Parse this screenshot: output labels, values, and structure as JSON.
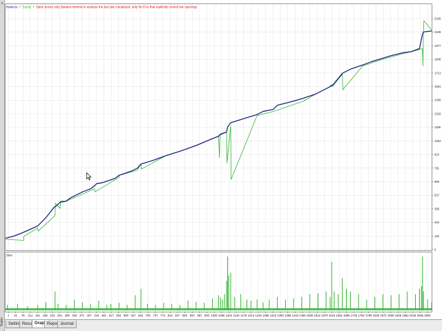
{
  "window": {
    "sidebar_label": "Tester",
    "close_glyph": "×"
  },
  "tabs": [
    {
      "label": "Settings",
      "active": false
    },
    {
      "label": "Results",
      "active": false
    },
    {
      "label": "Graph",
      "active": true
    },
    {
      "label": "Report",
      "active": false
    },
    {
      "label": "Journal",
      "active": false
    }
  ],
  "legend": {
    "balance_label": "Balance",
    "equity_label": "Equity",
    "note": "Open prices only (fastest method to analyze the bar just completed, only for EAs that explicitly control bar opening)",
    "separator": "/"
  },
  "size_panel": {
    "label": "Size"
  },
  "colors": {
    "balance": "#1a237e",
    "equity": "#2fb52f",
    "note": "#dd0000",
    "size_bars": "#2fb52f",
    "grid": "#c6c6c6"
  },
  "chart_data": {
    "type": "line",
    "y_ticks": [
      "2240",
      "2109",
      "1977",
      "1845",
      "1713",
      "1581",
      "1450",
      "1318",
      "1186",
      "1054",
      "922",
      "791",
      "659",
      "527",
      "395",
      "264",
      "132",
      "0"
    ],
    "ylim": [
      0,
      2240
    ],
    "x_ticks": [
      "1",
      "41",
      "78",
      "114",
      "151",
      "188",
      "224",
      "261",
      "298",
      "334",
      "371",
      "407",
      "444",
      "481",
      "517",
      "554",
      "590",
      "627",
      "664",
      "700",
      "737",
      "774",
      "810",
      "847",
      "883",
      "920",
      "957",
      "993",
      "1030",
      "1066",
      "1103",
      "1140",
      "1176",
      "1213",
      "1249",
      "1286",
      "1323",
      "1359",
      "1396",
      "1433",
      "1469",
      "1506",
      "1542",
      "1579",
      "1616",
      "1652",
      "1689",
      "1725",
      "1762",
      "1799",
      "1835",
      "1872",
      "1908",
      "1945",
      "1982",
      "2018",
      "2055",
      "2092"
    ],
    "xlim": [
      1,
      2100
    ],
    "series": [
      {
        "name": "Balance",
        "x": [
          1,
          40,
          80,
          160,
          200,
          240,
          255,
          270,
          300,
          320,
          340,
          380,
          420,
          440,
          450,
          480,
          540,
          560,
          620,
          650,
          668,
          720,
          790,
          870,
          940,
          1000,
          1050,
          1060,
          1090,
          1095,
          1110,
          1190,
          1240,
          1270,
          1320,
          1340,
          1380,
          1420,
          1470,
          1500,
          1530,
          1560,
          1590,
          1608,
          1615,
          1640,
          1660,
          1700,
          1760,
          1800,
          1850,
          1900,
          1960,
          2000,
          2040,
          2055,
          2060,
          2100
        ],
        "y": [
          110,
          130,
          160,
          230,
          310,
          410,
          430,
          460,
          470,
          500,
          520,
          560,
          590,
          620,
          640,
          650,
          690,
          720,
          760,
          790,
          830,
          860,
          910,
          960,
          1010,
          1060,
          1100,
          1120,
          1140,
          1190,
          1230,
          1280,
          1310,
          1340,
          1360,
          1400,
          1420,
          1440,
          1470,
          1490,
          1510,
          1540,
          1570,
          1590,
          1600,
          1660,
          1710,
          1750,
          1790,
          1820,
          1850,
          1880,
          1910,
          1920,
          1950,
          2090,
          2110,
          2120
        ]
      },
      {
        "name": "Equity",
        "x": [
          1,
          90,
          92,
          160,
          162,
          245,
          247,
          270,
          272,
          300,
          440,
          442,
          560,
          562,
          650,
          668,
          670,
          790,
          870,
          940,
          1000,
          1050,
          1055,
          1057,
          1090,
          1092,
          1110,
          1112,
          1240,
          1320,
          1470,
          1530,
          1590,
          1608,
          1610,
          1660,
          1662,
          1760,
          1850,
          1960,
          2040,
          2055,
          2057,
          2060,
          2062,
          2100
        ],
        "y": [
          100,
          90,
          130,
          210,
          180,
          330,
          450,
          400,
          470,
          470,
          590,
          560,
          700,
          720,
          770,
          830,
          780,
          910,
          960,
          1010,
          1060,
          1100,
          890,
          1110,
          1140,
          840,
          1200,
          680,
          1300,
          1340,
          1440,
          1510,
          1570,
          1600,
          1580,
          1700,
          1550,
          1780,
          1840,
          1900,
          1940,
          1950,
          1780,
          2120,
          2220,
          2130
        ]
      }
    ],
    "size_series": {
      "name": "Size",
      "x": [
        10,
        60,
        110,
        160,
        200,
        245,
        260,
        300,
        340,
        380,
        420,
        460,
        500,
        520,
        560,
        600,
        640,
        668,
        700,
        740,
        780,
        820,
        860,
        900,
        940,
        980,
        1020,
        1050,
        1060,
        1070,
        1080,
        1090,
        1095,
        1100,
        1110,
        1130,
        1160,
        1190,
        1210,
        1240,
        1270,
        1300,
        1340,
        1380,
        1420,
        1460,
        1500,
        1540,
        1580,
        1600,
        1608,
        1620,
        1640,
        1660,
        1680,
        1700,
        1740,
        1780,
        1820,
        1860,
        1900,
        1940,
        1980,
        2020,
        2040,
        2050,
        2055,
        2060,
        2080,
        2100
      ],
      "y": [
        0.1,
        0.12,
        0.08,
        0.1,
        0.15,
        0.35,
        0.12,
        0.1,
        0.2,
        0.15,
        0.12,
        0.18,
        0.1,
        0.12,
        0.14,
        0.1,
        0.28,
        0.4,
        0.12,
        0.1,
        0.14,
        0.12,
        0.1,
        0.18,
        0.16,
        0.14,
        0.22,
        0.28,
        0.24,
        0.2,
        0.3,
        0.55,
        1.0,
        0.65,
        0.7,
        0.25,
        0.3,
        0.2,
        0.18,
        0.2,
        0.15,
        0.2,
        0.25,
        0.2,
        0.22,
        0.25,
        0.3,
        0.32,
        0.35,
        0.25,
        0.9,
        0.35,
        0.3,
        0.6,
        0.4,
        0.35,
        0.3,
        0.2,
        0.25,
        0.3,
        0.28,
        0.3,
        0.35,
        0.3,
        0.4,
        0.45,
        1.0,
        0.35,
        0.2,
        0.15
      ]
    }
  }
}
